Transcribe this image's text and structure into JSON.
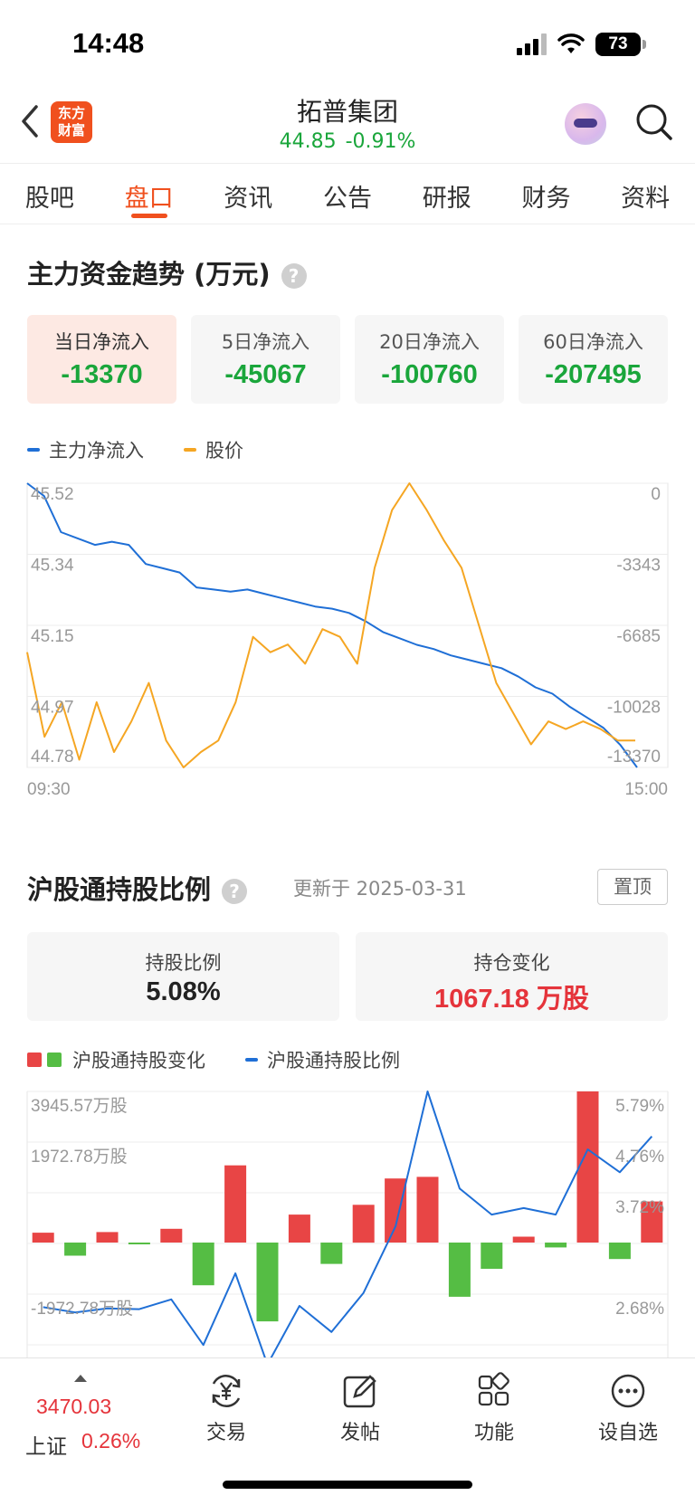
{
  "status": {
    "time": "14:48",
    "battery": "73"
  },
  "header": {
    "logo_line1": "东方",
    "logo_line2": "财富",
    "stock_name": "拓普集团",
    "price": "44.85",
    "change_pct": "-0.91%"
  },
  "tabs": [
    {
      "label": "股吧"
    },
    {
      "label": "盘口"
    },
    {
      "label": "资讯"
    },
    {
      "label": "公告"
    },
    {
      "label": "研报"
    },
    {
      "label": "财务"
    },
    {
      "label": "资料"
    }
  ],
  "active_tab": "盘口",
  "fund_section": {
    "title": "主力资金趋势 (万元)",
    "help": "?",
    "cards": [
      {
        "label": "当日净流入",
        "value": "-13370"
      },
      {
        "label": "5日净流入",
        "value": "-45067"
      },
      {
        "label": "20日净流入",
        "value": "-100760"
      },
      {
        "label": "60日净流入",
        "value": "-207495"
      }
    ],
    "legend": [
      {
        "label": "主力净流入",
        "color": "#1f6fd6"
      },
      {
        "label": "股价",
        "color": "#f5a623"
      }
    ]
  },
  "chart_data": [
    {
      "type": "line",
      "x_start": "09:30",
      "x_end": "15:00",
      "y_left_ticks": [
        "45.52",
        "45.34",
        "45.15",
        "44.97",
        "44.78"
      ],
      "y_right_ticks": [
        "0",
        "-3343",
        "-6685",
        "-10028",
        "-13370"
      ],
      "ylim_left": [
        44.78,
        45.52
      ],
      "ylim_right": [
        -13370,
        0
      ],
      "grid": true,
      "series": [
        {
          "name": "主力净流入",
          "axis": "right",
          "color": "#1f6fd6",
          "values": [
            0,
            -600,
            -2300,
            -2600,
            -2900,
            -2750,
            -2900,
            -3800,
            -4000,
            -4200,
            -4900,
            -5000,
            -5100,
            -5000,
            -5200,
            -5400,
            -5600,
            -5800,
            -5900,
            -6100,
            -6500,
            -7000,
            -7300,
            -7600,
            -7800,
            -8100,
            -8300,
            -8500,
            -8700,
            -9100,
            -9600,
            -9900,
            -10500,
            -11000,
            -11500,
            -12300,
            -13370
          ]
        },
        {
          "name": "股价",
          "axis": "left",
          "color": "#f5a623",
          "values": [
            45.08,
            44.86,
            44.95,
            44.8,
            44.95,
            44.82,
            44.9,
            45.0,
            44.85,
            44.78,
            44.82,
            44.85,
            44.95,
            45.12,
            45.08,
            45.1,
            45.05,
            45.14,
            45.12,
            45.05,
            45.3,
            45.45,
            45.52,
            45.45,
            45.37,
            45.3,
            45.15,
            45.0,
            44.92,
            44.84,
            44.9,
            44.88,
            44.9,
            44.88,
            44.85,
            44.85
          ]
        }
      ]
    },
    {
      "type": "bar",
      "y_left_ticks": [
        "3945.57万股",
        "1972.78万股",
        "-1972.78万股"
      ],
      "y_right_ticks": [
        "5.79%",
        "4.76%",
        "3.72%",
        "2.68%"
      ],
      "series": [
        {
          "name": "沪股通持股变化",
          "axis": "left",
          "values": [
            300,
            -400,
            320,
            -50,
            420,
            -1300,
            2350,
            -2400,
            850,
            -650,
            1150,
            1950,
            2000,
            -1650,
            -800,
            180,
            -150,
            4600,
            -500,
            1250
          ]
        },
        {
          "name": "沪股通持股比例",
          "axis": "right",
          "color": "#1f6fd6",
          "values": [
            2.48,
            2.4,
            2.46,
            2.45,
            2.6,
            1.9,
            3.0,
            1.6,
            2.5,
            2.1,
            2.7,
            3.72,
            5.79,
            4.3,
            3.9,
            4.0,
            3.9,
            4.9,
            4.55,
            5.1
          ]
        }
      ]
    }
  ],
  "hold_section": {
    "title": "沪股通持股比例",
    "help": "?",
    "update_label": "更新于 2025-03-31",
    "pin_label": "置顶",
    "cards": [
      {
        "label": "持股比例",
        "value": "5.08%"
      },
      {
        "label": "持仓变化",
        "value": "1067.18 万股"
      }
    ],
    "legend_change": "沪股通持股变化",
    "legend_ratio": "沪股通持股比例",
    "pos_color": "#e84545",
    "neg_color": "#55bd44",
    "line_color": "#1f6fd6"
  },
  "bottom_nav": {
    "index_value": "3470.03",
    "index_name": "上证",
    "index_pct": "0.26%",
    "items": [
      {
        "label": "交易",
        "icon": "yuan-exchange-icon"
      },
      {
        "label": "发帖",
        "icon": "edit-post-icon"
      },
      {
        "label": "功能",
        "icon": "grid-icon"
      },
      {
        "label": "设自选",
        "icon": "more-dots-icon"
      }
    ]
  }
}
